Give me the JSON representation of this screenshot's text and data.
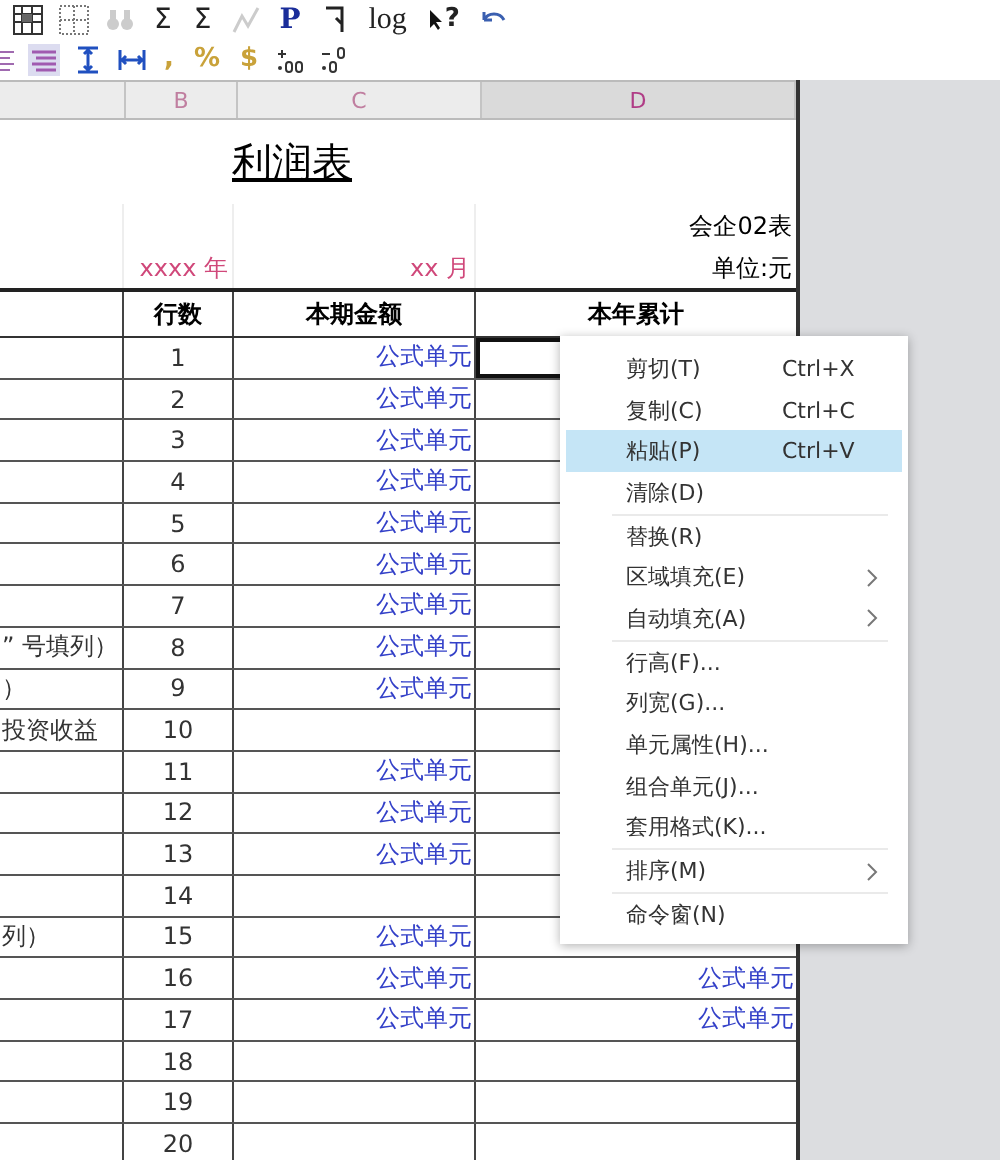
{
  "toolbar": {
    "row1_glyphs": [
      "Σ",
      "Σ",
      "P",
      "log",
      "?"
    ],
    "row2_glyphs": [
      ",",
      "%",
      "$"
    ]
  },
  "column_headers": [
    {
      "label": "B",
      "selected": false
    },
    {
      "label": "C",
      "selected": false
    },
    {
      "label": "D",
      "selected": true
    }
  ],
  "sheet": {
    "title": "利润表",
    "form_code": "会企02表",
    "year": "xxxx 年",
    "month": "xx 月",
    "unit": "单位:元",
    "headers": [
      "行数",
      "本期金额",
      "本年累计"
    ],
    "rows": [
      {
        "line": "1",
        "current": "公式单元",
        "selected": true
      },
      {
        "line": "2",
        "current": "公式单元",
        "selected": false
      },
      {
        "line": "3",
        "current": "公式单元",
        "selected": false
      },
      {
        "line": "4",
        "current": "公式单元",
        "selected": false
      },
      {
        "line": "5",
        "current": "公式单元",
        "selected": false
      },
      {
        "line": "6",
        "current": "公式单元",
        "selected": false
      },
      {
        "line": "7",
        "current": "公式单元",
        "selected": false
      },
      {
        "item": "” 号填列）",
        "line": "8",
        "current": "公式单元",
        "selected": false
      },
      {
        "item": "）",
        "line": "9",
        "current": "公式单元",
        "selected": false
      },
      {
        "item": "投资收益",
        "line": "10",
        "selected": false
      },
      {
        "line": "11",
        "current": "公式单元",
        "selected": false
      },
      {
        "line": "12",
        "current": "公式单元",
        "selected": false
      },
      {
        "line": "13",
        "current": "公式单元",
        "selected": false
      },
      {
        "line": "14",
        "selected": false
      },
      {
        "item": "列）",
        "line": "15",
        "current": "公式单元",
        "selected": false
      },
      {
        "line": "16",
        "current": "公式单元",
        "ytd": "公式单元",
        "selected": false
      },
      {
        "line": "17",
        "current": "公式单元",
        "ytd": "公式单元",
        "selected": false
      },
      {
        "line": "18",
        "selected": false
      },
      {
        "line": "19",
        "selected": false
      },
      {
        "line": "20",
        "selected": false
      }
    ]
  },
  "context_menu": {
    "groups": [
      [
        {
          "label": "剪切(T)",
          "shortcut": "Ctrl+X",
          "selected": false,
          "submenu": false
        },
        {
          "label": "复制(C)",
          "shortcut": "Ctrl+C",
          "selected": false,
          "submenu": false
        },
        {
          "label": "粘贴(P)",
          "shortcut": "Ctrl+V",
          "selected": true,
          "submenu": false
        },
        {
          "label": "清除(D)",
          "selected": false,
          "submenu": false
        }
      ],
      [
        {
          "label": "替换(R)",
          "selected": false,
          "submenu": false
        },
        {
          "label": "区域填充(E)",
          "selected": false,
          "submenu": true
        },
        {
          "label": "自动填充(A)",
          "selected": false,
          "submenu": true
        }
      ],
      [
        {
          "label": "行高(F)...",
          "selected": false,
          "submenu": false
        },
        {
          "label": "列宽(G)...",
          "selected": false,
          "submenu": false
        },
        {
          "label": "单元属性(H)...",
          "selected": false,
          "submenu": false
        },
        {
          "label": "组合单元(J)...",
          "selected": false,
          "submenu": false
        },
        {
          "label": "套用格式(K)...",
          "selected": false,
          "submenu": false
        }
      ],
      [
        {
          "label": "排序(M)",
          "selected": false,
          "submenu": true
        }
      ],
      [
        {
          "label": "命令窗(N)",
          "selected": false,
          "submenu": false
        }
      ]
    ]
  }
}
